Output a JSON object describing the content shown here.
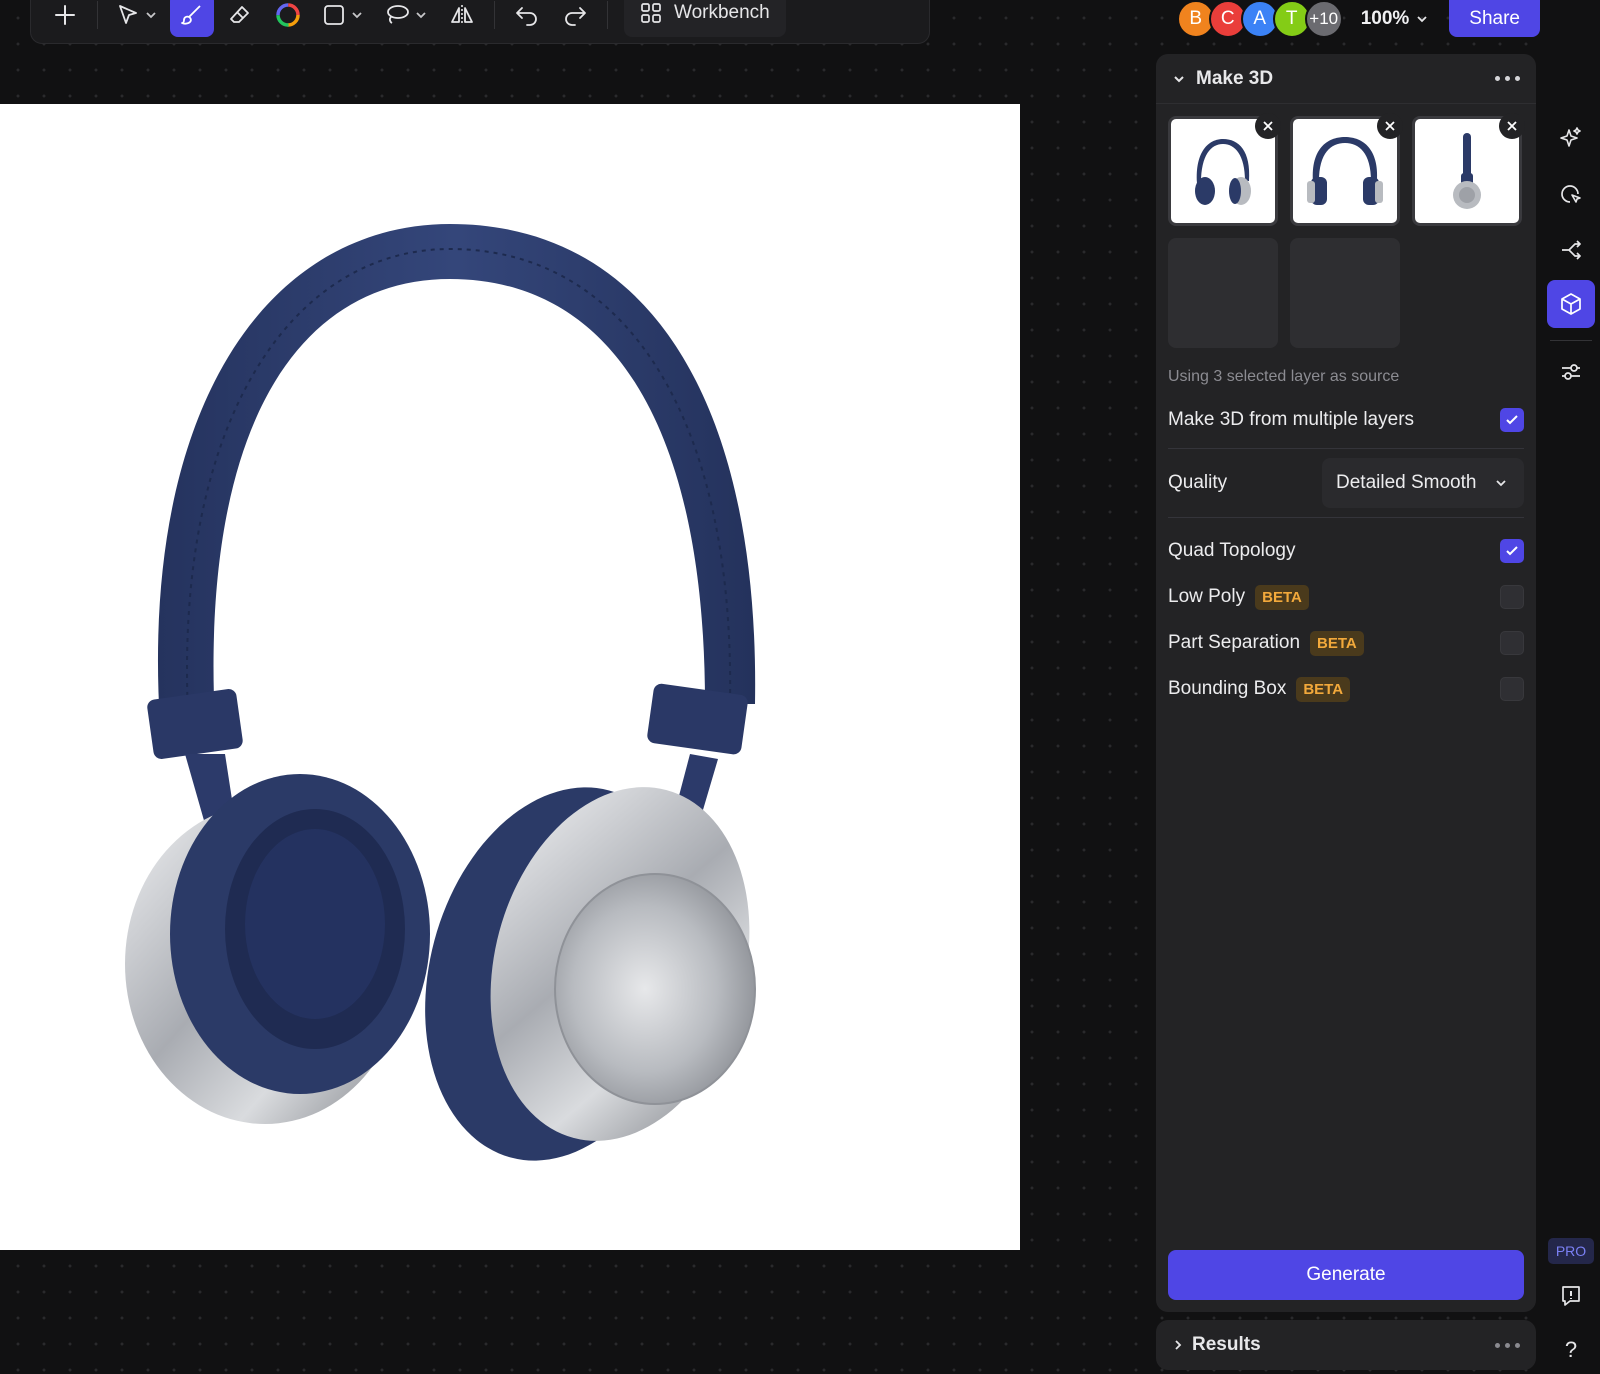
{
  "toolbar": {
    "tools": [
      {
        "name": "add",
        "icon": "plus-icon"
      },
      {
        "name": "select",
        "icon": "cursor-arrow-icon"
      },
      {
        "name": "brush",
        "icon": "brush-icon",
        "active": true
      },
      {
        "name": "eraser",
        "icon": "eraser-icon"
      },
      {
        "name": "color",
        "icon": "color-ring-icon"
      },
      {
        "name": "shape",
        "icon": "square-icon"
      },
      {
        "name": "lasso",
        "icon": "lasso-icon"
      },
      {
        "name": "flip",
        "icon": "flip-horizontal-icon"
      },
      {
        "name": "undo",
        "icon": "undo-icon"
      },
      {
        "name": "redo",
        "icon": "redo-icon"
      }
    ],
    "workbench_label": "Workbench"
  },
  "collaborators": [
    {
      "initial": "B",
      "color": "#f0831e"
    },
    {
      "initial": "C",
      "color": "#ea3e3a"
    },
    {
      "initial": "A",
      "color": "#3b82f6"
    },
    {
      "initial": "T",
      "color": "#84cc16"
    }
  ],
  "collaborators_more": "+10",
  "zoom": "100%",
  "share_label": "Share",
  "current_user_initial": "B",
  "colors": {
    "accent": "#4f46e5",
    "headband": "#2b3a67",
    "metal": "#c5c7cb",
    "beta_text": "#f2a93b"
  },
  "panel": {
    "title": "Make 3D",
    "source_note": "Using 3 selected layer as source",
    "multi_layer": {
      "label": "Make 3D from multiple layers",
      "checked": true
    },
    "quality": {
      "label": "Quality",
      "value": "Detailed Smooth"
    },
    "options": [
      {
        "label": "Quad Topology",
        "beta": "",
        "checked": true
      },
      {
        "label": "Low Poly",
        "beta": "BETA",
        "checked": false
      },
      {
        "label": "Part Separation",
        "beta": "BETA",
        "checked": false
      },
      {
        "label": "Bounding Box",
        "beta": "BETA",
        "checked": false
      }
    ],
    "generate_label": "Generate"
  },
  "results": {
    "title": "Results"
  },
  "rail": {
    "items": [
      {
        "icon": "sparkle-icon"
      },
      {
        "icon": "chat-cursor-icon"
      },
      {
        "icon": "branch-icon"
      },
      {
        "icon": "cube-icon",
        "active": true
      },
      {
        "icon": "sliders-icon"
      }
    ],
    "pro_label": "PRO",
    "feedback_icon": "feedback-icon",
    "help_label": "?"
  }
}
